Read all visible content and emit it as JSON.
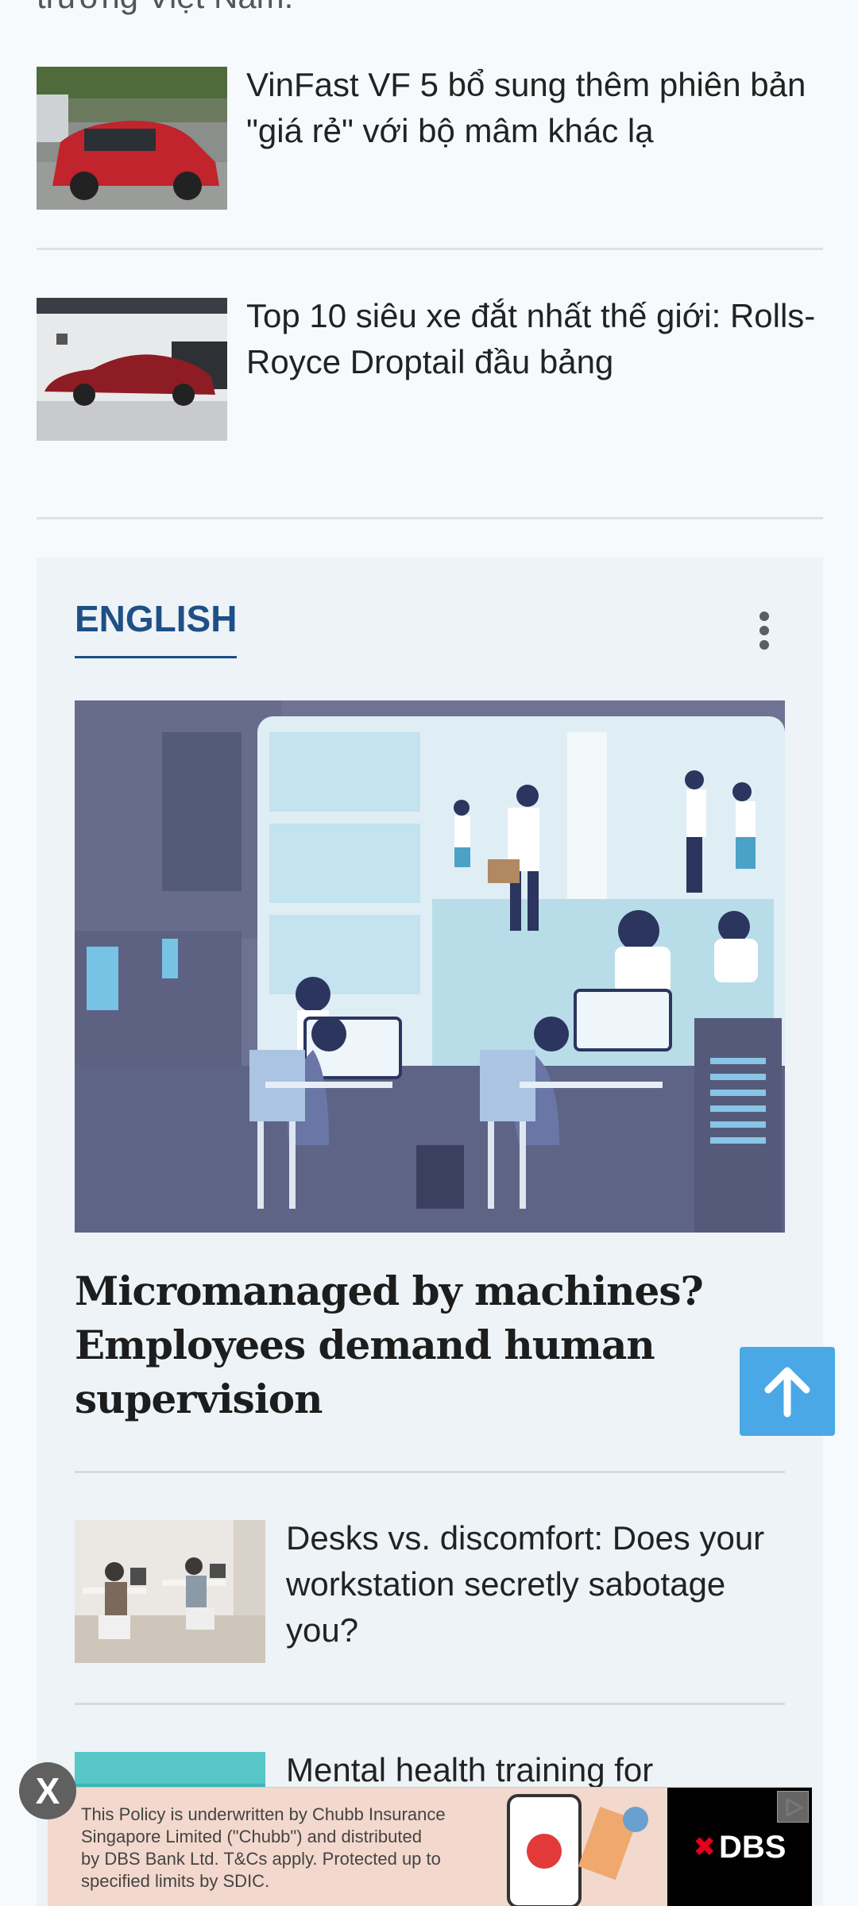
{
  "top_cut_text": "trường Việt Nam.",
  "news": [
    {
      "title": "VinFast VF 5 bổ sung thêm phiên bản \"giá rẻ\" với bộ mâm khác lạ",
      "thumb": "red-car-parking-image"
    },
    {
      "title": "Top 10 siêu xe đắt nhất thế giới: Rolls-Royce Droptail đầu bảng",
      "thumb": "red-luxury-car-showroom-image"
    }
  ],
  "english": {
    "section_title": "ENGLISH",
    "hero_title": "Micromanaged by machines? Employees demand human supervision",
    "articles": [
      {
        "title": "Desks vs. discomfort: Does your workstation secretly sabotage you?"
      },
      {
        "title": "Mental health training for"
      }
    ]
  },
  "ad": {
    "text_lines": [
      "This Policy is underwritten by Chubb Insurance",
      "Singapore Limited (\"Chubb\") and distributed",
      "by DBS Bank Ltd. T&Cs apply. Protected up to",
      "specified limits by SDIC."
    ],
    "brand": "DBS",
    "close_label": "X"
  },
  "colors": {
    "accent": "#1e4f86",
    "back_to_top": "#4aa8e6",
    "box_bg": "#edf3f6"
  }
}
